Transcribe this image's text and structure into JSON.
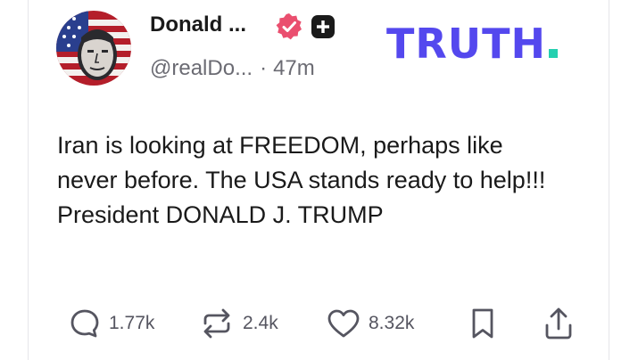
{
  "author": {
    "display_name": "Donald ...",
    "handle": "@realDo...",
    "separator": "·",
    "time_ago": "47m",
    "avatar_icon": "portrait-flag-avatar",
    "verified_icon": "verified-badge-icon",
    "verified_color": "#ea4f6f",
    "add_icon": "plus-square-icon"
  },
  "brand": {
    "logo_text": "TRUTH",
    "logo_color": "#5448ee",
    "dot_color": "#25d0b0"
  },
  "post": {
    "text": "Iran is looking at FREEDOM, perhaps like never before. The USA stands ready to help!!! President DONALD J. TRUMP"
  },
  "actions": {
    "replies": {
      "icon": "reply-bubble-icon",
      "count": "1.77k"
    },
    "retruths": {
      "icon": "retruth-icon",
      "count": "2.4k"
    },
    "likes": {
      "icon": "heart-icon",
      "count": "8.32k"
    },
    "bookmark": {
      "icon": "bookmark-icon"
    },
    "share": {
      "icon": "share-icon"
    }
  }
}
